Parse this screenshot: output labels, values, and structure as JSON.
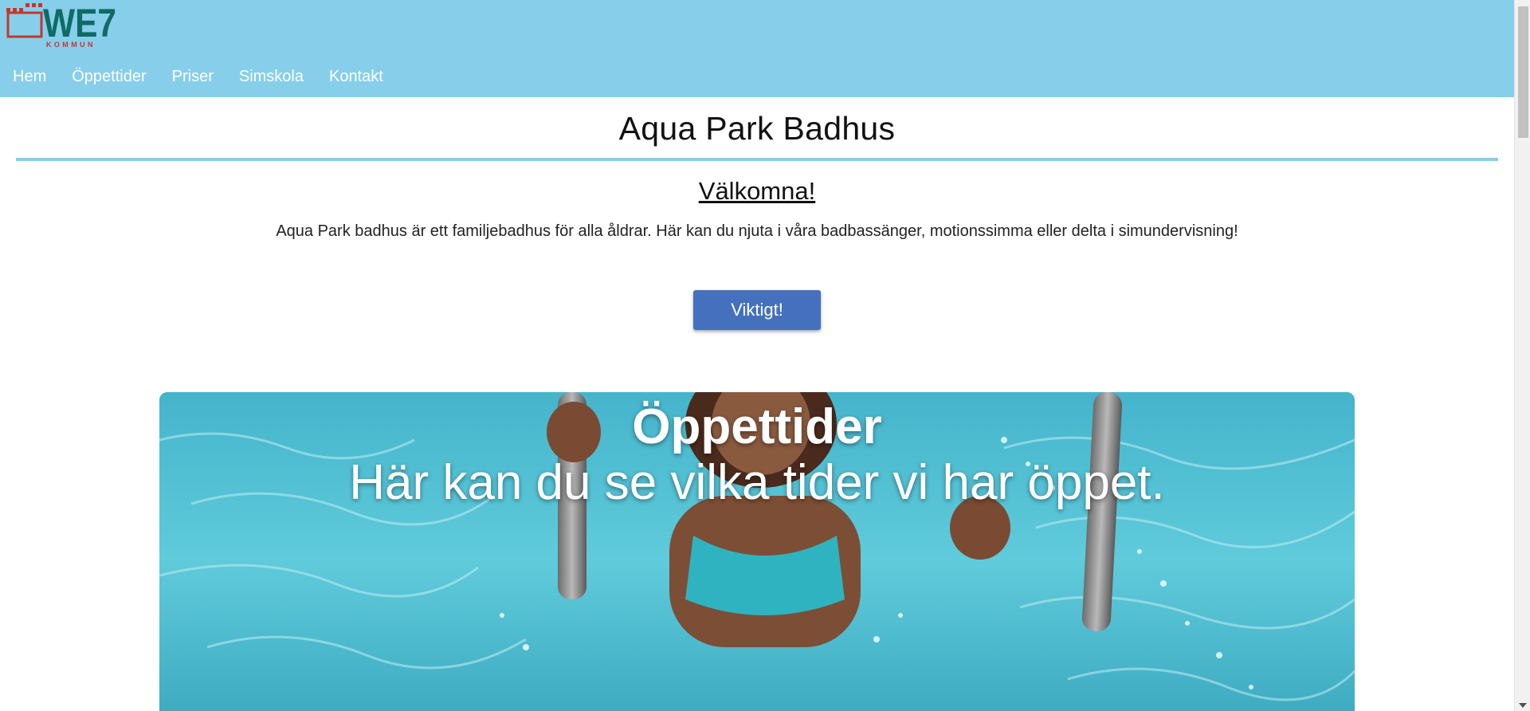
{
  "logo": {
    "wordmark": "WE7",
    "sub": "KOMMUN",
    "primary_color": "#0f6b63",
    "accent_color": "#c0392b"
  },
  "header": {
    "background": "#87ceeb",
    "nav": [
      {
        "label": "Hem"
      },
      {
        "label": "Öppettider"
      },
      {
        "label": "Priser"
      },
      {
        "label": "Simskola"
      },
      {
        "label": "Kontakt"
      }
    ]
  },
  "main": {
    "title": "Aqua Park Badhus",
    "welcome": "Välkomna!",
    "intro": "Aqua Park badhus är ett familjebadhus för alla åldrar. Här kan du njuta i våra badbassänger, motionssimma eller delta i simundervisning!",
    "important_button": "Viktigt!",
    "button_color": "#4470bd"
  },
  "hero": {
    "title": "Öppettider",
    "subtitle": "Här kan du se vilka tider vi har öppet."
  }
}
